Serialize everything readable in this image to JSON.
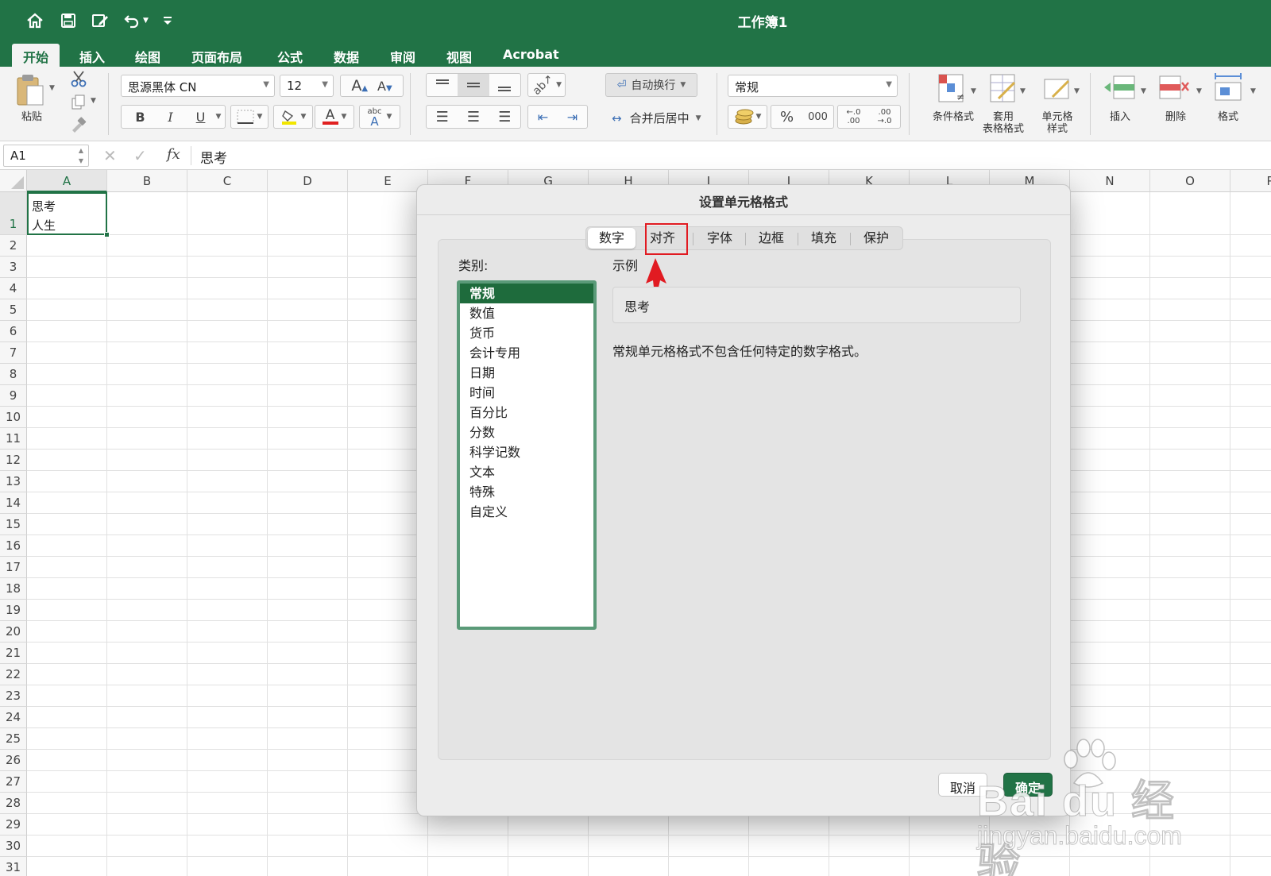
{
  "app": {
    "title": "工作簿1"
  },
  "ribbon_tabs": [
    "开始",
    "插入",
    "绘图",
    "页面布局",
    "公式",
    "数据",
    "审阅",
    "视图",
    "Acrobat"
  ],
  "ribbon": {
    "paste": "粘贴",
    "font_name": "思源黑体 CN",
    "font_size": "12",
    "grow_font": "A",
    "shrink_font": "A",
    "bold": "B",
    "italic": "I",
    "underline": "U",
    "font_color": "A",
    "abc": "abc",
    "wrap_text": "自动换行",
    "merge_center": "合并后居中",
    "number_format": "常规",
    "percent": "%",
    "thousands": "000",
    "inc_decimal_top": "←.0",
    "inc_decimal_bottom": ".00",
    "dec_decimal_top": ".00",
    "dec_decimal_bottom": "→.0",
    "cond_format": "条件格式",
    "table_format_1": "套用",
    "table_format_2": "表格格式",
    "cell_style_1": "单元格",
    "cell_style_2": "样式",
    "insert": "插入",
    "delete": "删除",
    "format": "格式"
  },
  "formula_bar": {
    "name_box": "A1",
    "fx": "fx",
    "content": "思考"
  },
  "grid": {
    "columns": [
      "A",
      "B",
      "C",
      "D",
      "E",
      "F",
      "G",
      "H",
      "I",
      "J",
      "K",
      "L",
      "M",
      "N",
      "O",
      "P"
    ],
    "rows": [
      "1",
      "2",
      "3",
      "4",
      "5",
      "6",
      "7",
      "8",
      "9",
      "10",
      "11",
      "12",
      "13",
      "14",
      "15",
      "16",
      "17",
      "18",
      "19",
      "20",
      "21",
      "22",
      "23",
      "24",
      "25",
      "26",
      "27",
      "28",
      "29",
      "30",
      "31"
    ],
    "a1_line1": "思考",
    "a1_line2": "人生"
  },
  "dialog": {
    "title": "设置单元格格式",
    "tabs": [
      "数字",
      "对齐",
      "字体",
      "边框",
      "填充",
      "保护"
    ],
    "category_label": "类别:",
    "categories": [
      "常规",
      "数值",
      "货币",
      "会计专用",
      "日期",
      "时间",
      "百分比",
      "分数",
      "科学记数",
      "文本",
      "特殊",
      "自定义"
    ],
    "sample_label": "示例",
    "sample_value": "思考",
    "description": "常规单元格格式不包含任何特定的数字格式。",
    "cancel": "取消",
    "ok": "确定"
  },
  "watermark": {
    "brand": "Bai du 经验",
    "url": "jingyan.baidu.com"
  },
  "colors": {
    "brand_green": "#217346",
    "selected_green": "#1e6b3c",
    "annotation_red": "#e11b22"
  }
}
